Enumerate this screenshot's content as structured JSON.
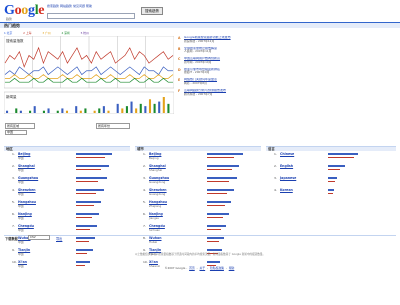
{
  "header": {
    "logo_letters": [
      "G",
      "o",
      "o",
      "g",
      "l",
      "e"
    ],
    "logo_sub": "趋势",
    "links": [
      "搜索趋势",
      "网站趋势",
      "常见问题",
      "帮助"
    ],
    "search_button": "搜索趋势"
  },
  "page_title": "热门趋势",
  "legend": [
    "1 北京",
    "2 上海",
    "3 广州",
    "4 深圳",
    "5 杭州"
  ],
  "chart_data": {
    "type": "line",
    "title": "",
    "panels": [
      "搜索量指数",
      "新闻量"
    ],
    "series": [
      {
        "color": "#c0392b",
        "values": [
          6,
          8,
          7,
          9,
          5,
          8,
          7,
          10,
          6,
          9,
          8,
          7,
          9,
          6,
          8,
          10,
          7,
          8,
          6,
          9,
          7,
          8,
          9,
          6,
          7,
          8,
          10,
          7,
          9,
          8,
          6,
          7,
          8,
          9,
          7,
          8
        ]
      },
      {
        "color": "#3a5fc0",
        "values": [
          3,
          4,
          3,
          5,
          4,
          3,
          4,
          4,
          5,
          3,
          4,
          5,
          4,
          3,
          4,
          5,
          3,
          4,
          4,
          5,
          3,
          4,
          5,
          4,
          3,
          4,
          5,
          4,
          3,
          5,
          4,
          4,
          3,
          5,
          4,
          4
        ]
      },
      {
        "color": "#e3a21a",
        "values": [
          2,
          2,
          3,
          2,
          2,
          3,
          2,
          2,
          3,
          2,
          2,
          2,
          3,
          2,
          2,
          3,
          2,
          2,
          2,
          3,
          2,
          2,
          3,
          2,
          2,
          2,
          3,
          2,
          2,
          3,
          2,
          2,
          3,
          2,
          2,
          3
        ]
      },
      {
        "color": "#1b8a2e",
        "values": [
          1,
          1,
          2,
          1,
          1,
          1,
          2,
          1,
          1,
          2,
          1,
          1,
          1,
          2,
          1,
          1,
          2,
          1,
          1,
          1,
          2,
          1,
          1,
          2,
          1,
          1,
          1,
          2,
          1,
          1,
          2,
          1,
          1,
          2,
          1,
          1
        ]
      }
    ],
    "news_volume": [
      1,
      0,
      2,
      1,
      0,
      1,
      3,
      0,
      1,
      2,
      0,
      1,
      2,
      1,
      0,
      3,
      1,
      2,
      0,
      1,
      2,
      3,
      1,
      0,
      4,
      2,
      3,
      5,
      2,
      4,
      3,
      6,
      4,
      5,
      7,
      4
    ]
  },
  "news": [
    {
      "letter": "A",
      "title": "Google新版搜索趋势功能上线发布",
      "source": "新浪科技 - 2007年12月"
    },
    {
      "letter": "B",
      "title": "全球搜索量统计报告解读",
      "source": "人民网 - 2007年11月"
    },
    {
      "letter": "C",
      "title": "中国互联网用户数再创新高",
      "source": "新华网 - 2007年10月"
    },
    {
      "letter": "D",
      "title": "搜索引擎市场份额最新排名",
      "source": "搜狐IT - 2007年9月"
    },
    {
      "letter": "E",
      "title": "网络热门关键词年度盘点",
      "source": "网易 - 2007年8月"
    },
    {
      "letter": "F",
      "title": "互联网趋势分析与预测报告发布",
      "source": "腾讯科技 - 2007年7月"
    }
  ],
  "selectors": {
    "region": "所有区域",
    "region2": "中国",
    "time": "所有年份"
  },
  "columns": [
    {
      "header": "地区",
      "items": [
        {
          "name": "Beijing",
          "sub": "中国",
          "bar1": 1.0,
          "bar2": 0.8
        },
        {
          "name": "Shanghai",
          "sub": "中国",
          "bar1": 0.92,
          "bar2": 0.7
        },
        {
          "name": "Guangzhou",
          "sub": "中国",
          "bar1": 0.85,
          "bar2": 0.6
        },
        {
          "name": "Shenzhen",
          "sub": "中国",
          "bar1": 0.78,
          "bar2": 0.55
        },
        {
          "name": "Hangzhou",
          "sub": "中国",
          "bar1": 0.7,
          "bar2": 0.5
        },
        {
          "name": "Nanjing",
          "sub": "中国",
          "bar1": 0.64,
          "bar2": 0.45
        },
        {
          "name": "Chengdu",
          "sub": "中国",
          "bar1": 0.58,
          "bar2": 0.4
        },
        {
          "name": "Wuhan",
          "sub": "中国",
          "bar1": 0.52,
          "bar2": 0.35
        },
        {
          "name": "Tianjin",
          "sub": "中国",
          "bar1": 0.46,
          "bar2": 0.3
        },
        {
          "name": "Xi'an",
          "sub": "中国",
          "bar1": 0.4,
          "bar2": 0.25
        }
      ]
    },
    {
      "header": "城市",
      "items": [
        {
          "name": "Beijing",
          "sub": "Beijing",
          "bar1": 1.0,
          "bar2": 0.75
        },
        {
          "name": "Shanghai",
          "sub": "Shanghai",
          "bar1": 0.9,
          "bar2": 0.7
        },
        {
          "name": "Guangzhou",
          "sub": "Guangdong",
          "bar1": 0.82,
          "bar2": 0.62
        },
        {
          "name": "Shenzhen",
          "sub": "Guangdong",
          "bar1": 0.75,
          "bar2": 0.55
        },
        {
          "name": "Hangzhou",
          "sub": "Zhejiang",
          "bar1": 0.68,
          "bar2": 0.5
        },
        {
          "name": "Nanjing",
          "sub": "Jiangsu",
          "bar1": 0.6,
          "bar2": 0.44
        },
        {
          "name": "Chengdu",
          "sub": "Sichuan",
          "bar1": 0.54,
          "bar2": 0.38
        },
        {
          "name": "Wuhan",
          "sub": "Hubei",
          "bar1": 0.48,
          "bar2": 0.34
        },
        {
          "name": "Tianjin",
          "sub": "Tianjin",
          "bar1": 0.42,
          "bar2": 0.3
        },
        {
          "name": "Xi'an",
          "sub": "Shaanxi",
          "bar1": 0.36,
          "bar2": 0.26
        }
      ]
    },
    {
      "header": "语言",
      "items": [
        {
          "name": "Chinese",
          "sub": "",
          "bar1": 1.0,
          "bar2": 0.85
        },
        {
          "name": "English",
          "sub": "",
          "bar1": 0.55,
          "bar2": 0.4
        },
        {
          "name": "Japanese",
          "sub": "",
          "bar1": 0.3,
          "bar2": 0.22
        },
        {
          "name": "Korean",
          "sub": "",
          "bar1": 0.2,
          "bar2": 0.15
        }
      ]
    }
  ],
  "footer": {
    "label": "下载数据",
    "select": "CSV",
    "link": "导出",
    "disclaimer": "以上数据仅供参考。搜索量指数基于所选时间段内的平均搜索流量。新闻量指数基于 Google 新闻中的报道数量。",
    "copyright": "©2007 Google",
    "links": [
      "首页",
      "关于",
      "隐私权政策",
      "帮助"
    ]
  }
}
